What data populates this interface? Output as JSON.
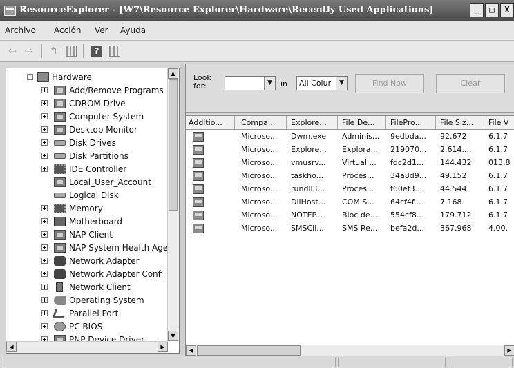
{
  "window": {
    "title": "ResourceExplorer - [W7\\Resource Explorer\\Hardware\\Recently Used Applications]",
    "buttons": [
      "_",
      "□",
      "X"
    ]
  },
  "menu": {
    "items": [
      "Archivo",
      "Acción",
      "Ver",
      "Ayuda"
    ]
  },
  "toolbar": {
    "icons": [
      "back-arrow-icon",
      "forward-arrow-icon",
      "up-folder-icon",
      "show-hide-tree-icon",
      "help-icon",
      "properties-icon"
    ]
  },
  "tree": {
    "root": "Hardware",
    "items": [
      "Add/Remove Programs",
      "CDROM Drive",
      "Computer System",
      "Desktop Monitor",
      "Disk Drives",
      "Disk Partitions",
      "IDE Controller",
      "Local_User_Account",
      "Logical Disk",
      "Memory",
      "Motherboard",
      "NAP Client",
      "NAP System Health Age",
      "Network Adapter",
      "Network Adapter Confi",
      "Network Client",
      "Operating System",
      "Parallel Port",
      "PC BIOS",
      "PNP Device Driver"
    ]
  },
  "search": {
    "look_for_label": "Look for:",
    "look_for_value": "",
    "in_label": "in",
    "in_value": "All Colur",
    "find_now": "Find Now",
    "clear": "Clear"
  },
  "list": {
    "columns": [
      "Additio...",
      "Compa...",
      "Explore...",
      "File De...",
      "FilePro...",
      "File Siz...",
      "File V"
    ],
    "rows": [
      [
        "",
        "Microso...",
        "Dwm.exe",
        "Adminis...",
        "9edbda...",
        "92.672",
        "6.1.7"
      ],
      [
        "",
        "Microso...",
        "Explore...",
        "Explora...",
        "219070...",
        "2.614....",
        "6.1.7"
      ],
      [
        "",
        "Microso...",
        "vmusrv...",
        "Virtual ...",
        "fdc2d1...",
        "144.432",
        "013.8"
      ],
      [
        "",
        "Microso...",
        "taskho...",
        "Proces...",
        "34a8d9...",
        "49.152",
        "6.1.7"
      ],
      [
        "",
        "Microso...",
        "rundll3...",
        "Proces...",
        "f60ef3...",
        "44.544",
        "6.1.7"
      ],
      [
        "",
        "Microso...",
        "DllHost...",
        "COM S...",
        "64cf4f...",
        "7.168",
        "6.1.7"
      ],
      [
        "",
        "Microso...",
        "NOTEP...",
        "Bloc de...",
        "554cf8...",
        "179.712",
        "6.1.7"
      ],
      [
        "",
        "Microso...",
        "SMSCli...",
        "SMS Re...",
        "befa2d...",
        "367.968",
        "4.00."
      ]
    ]
  }
}
